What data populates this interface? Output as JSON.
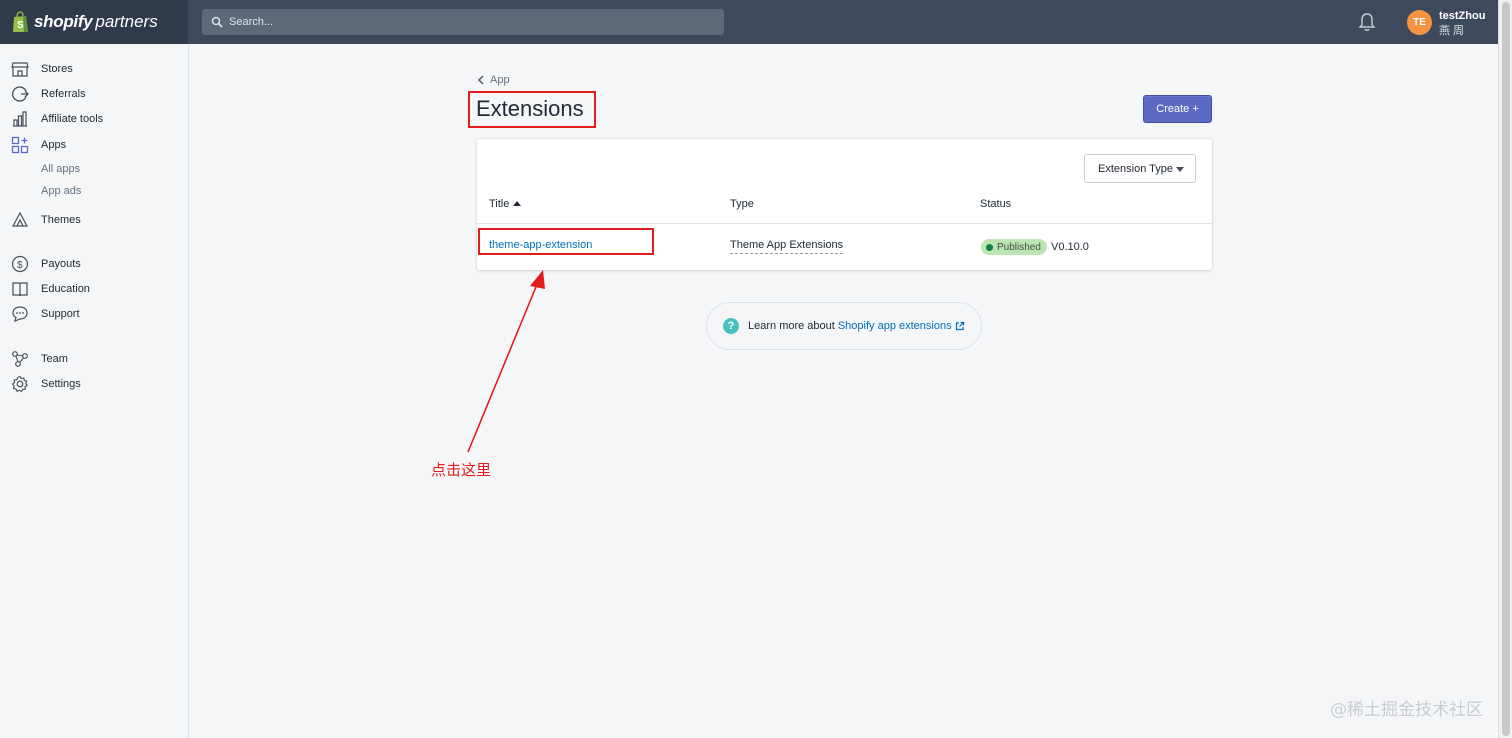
{
  "header": {
    "brand_bold": "shopify",
    "brand_light": "partners",
    "search_placeholder": "Search...",
    "user": {
      "initials": "TE",
      "name": "testZhou",
      "subtitle": "燕 周"
    }
  },
  "sidebar": {
    "items": [
      {
        "label": "Stores",
        "icon": "store-icon"
      },
      {
        "label": "Referrals",
        "icon": "referrals-icon"
      },
      {
        "label": "Affiliate tools",
        "icon": "affiliate-tools-icon"
      },
      {
        "label": "Apps",
        "icon": "apps-icon"
      },
      {
        "label": "All apps"
      },
      {
        "label": "App ads"
      },
      {
        "label": "Themes",
        "icon": "themes-icon"
      },
      {
        "label": "Payouts",
        "icon": "payouts-icon"
      },
      {
        "label": "Education",
        "icon": "education-icon"
      },
      {
        "label": "Support",
        "icon": "support-icon"
      },
      {
        "label": "Team",
        "icon": "team-icon"
      },
      {
        "label": "Settings",
        "icon": "settings-icon"
      }
    ]
  },
  "main": {
    "breadcrumb": "App",
    "title": "Extensions",
    "create_label": "Create +",
    "filter_label": "Extension Type",
    "columns": [
      "Title",
      "Type",
      "Status"
    ],
    "rows": [
      {
        "title": "theme-app-extension",
        "type": "Theme App Extensions",
        "status": "Published",
        "version": "V0.10.0"
      }
    ],
    "learn_text": "Learn more about",
    "learn_link": "Shopify app extensions"
  },
  "annotation": {
    "text": "点击这里",
    "color": "#e31d1d"
  },
  "watermark": "@稀土掘金技术社区",
  "colors": {
    "accent": "#5c6ac4",
    "link": "#006fbb",
    "topbar": "#3e4a5c",
    "published_badge": "#bbe5b3"
  }
}
